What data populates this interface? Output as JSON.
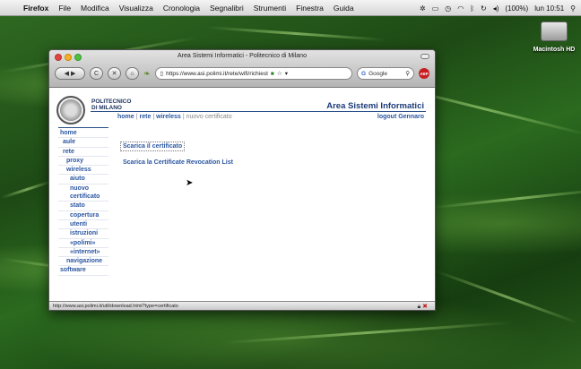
{
  "menubar": {
    "app": "Firefox",
    "items": [
      "File",
      "Modifica",
      "Visualizza",
      "Cronologia",
      "Segnalibri",
      "Strumenti",
      "Finestra",
      "Guida"
    ],
    "battery": "(100%)",
    "clock": "lun 10:51"
  },
  "desktop": {
    "drive_label": "Macintosh HD"
  },
  "window": {
    "title": "Area Sistemi Informatici - Politecnico di Milano",
    "url": "https://www.asi.polimi.it/rete/wifi/richiest",
    "search_placeholder": "Google",
    "adblock": "ABP",
    "status_url": "http://www.asi.polimi.it/util/download.html?type=certificato"
  },
  "page": {
    "logo_line1": "POLITECNICO",
    "logo_line2": "DI MILANO",
    "site_title": "Area Sistemi Informatici",
    "breadcrumb": {
      "home": "home",
      "rete": "rete",
      "wireless": "wireless",
      "current": "nuovo certificato"
    },
    "logout": "logout Gennaro",
    "nav": [
      {
        "label": "home",
        "level": 0
      },
      {
        "label": "aule",
        "level": 1
      },
      {
        "label": "rete",
        "level": 1
      },
      {
        "label": "proxy",
        "level": 2
      },
      {
        "label": "wireless",
        "level": 2
      },
      {
        "label": "aiuto",
        "level": 3
      },
      {
        "label": "nuovo certificato",
        "level": 3
      },
      {
        "label": "stato",
        "level": 3
      },
      {
        "label": "copertura",
        "level": 3
      },
      {
        "label": "utenti",
        "level": 3
      },
      {
        "label": "istruzioni",
        "level": 3
      },
      {
        "label": "«polimi»",
        "level": 3
      },
      {
        "label": "«internet»",
        "level": 3
      },
      {
        "label": "navigazione",
        "level": 2
      },
      {
        "label": "software",
        "level": 0
      }
    ],
    "links": [
      "Scarica il certificato",
      "Scarica la Certificate Revocation List"
    ]
  }
}
